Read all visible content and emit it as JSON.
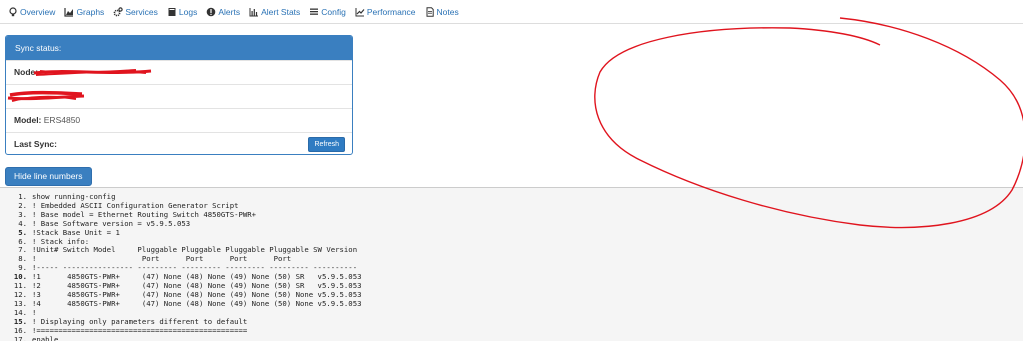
{
  "nav": {
    "items": [
      {
        "label": "Overview",
        "icon": "lightbulb-icon"
      },
      {
        "label": "Graphs",
        "icon": "area-chart-icon"
      },
      {
        "label": "Services",
        "icon": "cogs-icon"
      },
      {
        "label": "Logs",
        "icon": "book-icon"
      },
      {
        "label": "Alerts",
        "icon": "exclamation-circle-icon"
      },
      {
        "label": "Alert Stats",
        "icon": "bar-chart-icon"
      },
      {
        "label": "Config",
        "icon": "align-justify-icon"
      },
      {
        "label": "Performance",
        "icon": "line-chart-icon"
      },
      {
        "label": "Notes",
        "icon": "file-text-icon"
      }
    ]
  },
  "sync": {
    "header": "Sync status:",
    "node_label": "Node:",
    "model_label": "Model:",
    "model_value": "ERS4850",
    "last_sync_label": "Last Sync:",
    "refresh_label": "Refresh"
  },
  "hide_lines_label": "Hide line numbers",
  "code": {
    "lines": [
      {
        "n": "1.",
        "bold": false,
        "text": "show running-config"
      },
      {
        "n": "2.",
        "bold": false,
        "text": "! Embedded ASCII Configuration Generator Script"
      },
      {
        "n": "3.",
        "bold": false,
        "text": "! Base model = Ethernet Routing Switch 4850GTS-PWR+"
      },
      {
        "n": "4.",
        "bold": false,
        "text": "! Base Software version = v5.9.5.053"
      },
      {
        "n": "5.",
        "bold": true,
        "text": "!Stack Base Unit = 1"
      },
      {
        "n": "6.",
        "bold": false,
        "text": "! Stack info:"
      },
      {
        "n": "7.",
        "bold": false,
        "text": "!Unit# Switch Model     Pluggable Pluggable Pluggable Pluggable SW Version"
      },
      {
        "n": "8.",
        "bold": false,
        "text": "!                        Port      Port      Port      Port"
      },
      {
        "n": "9.",
        "bold": false,
        "text": "!----- ---------------- --------- --------- --------- --------- ----------"
      },
      {
        "n": "10.",
        "bold": true,
        "text": "!1      4850GTS-PWR+     (47) None (48) None (49) None (50) SR   v5.9.5.053"
      },
      {
        "n": "11.",
        "bold": false,
        "text": "!2      4850GTS-PWR+     (47) None (48) None (49) None (50) SR   v5.9.5.053"
      },
      {
        "n": "12.",
        "bold": false,
        "text": "!3      4850GTS-PWR+     (47) None (48) None (49) None (50) None v5.9.5.053"
      },
      {
        "n": "13.",
        "bold": false,
        "text": "!4      4850GTS-PWR+     (47) None (48) None (49) None (50) None v5.9.5.053"
      },
      {
        "n": "14.",
        "bold": false,
        "text": "!"
      },
      {
        "n": "15.",
        "bold": true,
        "text": "! Displaying only parameters different to default"
      },
      {
        "n": "16.",
        "bold": false,
        "text": "!================================================"
      },
      {
        "n": "17.",
        "bold": false,
        "text": "enable"
      }
    ]
  },
  "colors": {
    "accent": "#3a7fc0",
    "link": "#2a72b5",
    "annotation": "#e0141e"
  }
}
